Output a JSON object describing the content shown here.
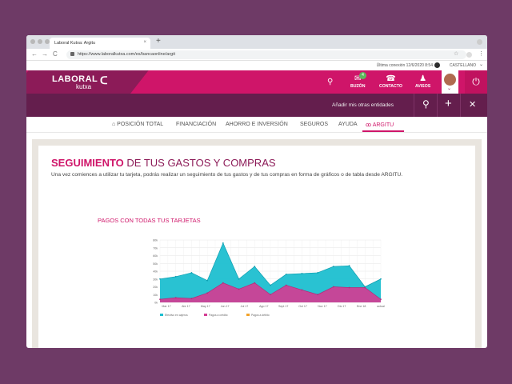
{
  "browser": {
    "tab_title": "Laboral Kutxa: Argitu",
    "tab_close": "×",
    "new_tab": "+",
    "url": "https://www.laboralkutxa.com/es/bancaonline/argit",
    "back": "←",
    "forward": "→",
    "reload": "C",
    "star": "☆",
    "more": "⋮"
  },
  "infobar": {
    "last_connection": "Última conexión 12/6/2020 8:54",
    "language": "CASTELLANO"
  },
  "header": {
    "logo_text": "LABORAL",
    "logo_sub": "kutxa",
    "logo_mark": "ᑕ",
    "icons": [
      {
        "name": "search",
        "glyph": "⚲",
        "label": ""
      },
      {
        "name": "buzon",
        "glyph": "✉",
        "label": "BUZÓN",
        "badge": "4"
      },
      {
        "name": "contacto",
        "glyph": "☎",
        "label": "CONTACTO"
      },
      {
        "name": "avisos",
        "glyph": "♟",
        "label": "AVISOS"
      }
    ],
    "power_glyph": "⏻"
  },
  "subheader": {
    "add_entities": "Añadir mis otras entidades",
    "pin_glyph": "⚲",
    "plus_glyph": "+",
    "close_glyph": "✕"
  },
  "menu": [
    {
      "label": "⌂ POSICIÓN TOTAL",
      "active": false
    },
    {
      "label": "FINANCIACIÓN",
      "active": false
    },
    {
      "label": "AHORRO E INVERSIÓN",
      "active": false
    },
    {
      "label": "SEGUROS",
      "active": false
    },
    {
      "label": "AYUDA",
      "active": false
    },
    {
      "label": "ARGITU",
      "active": true
    }
  ],
  "page": {
    "title_bold": "SEGUIMIENTO",
    "title_rest": " DE TUS GASTOS Y COMPRAS",
    "description": "Una vez comiences a utilizar tu tarjeta, podrás realizar un seguimiento de tus gastos y de tus compras en forma de gráficos o de tabla desde ARGITU.",
    "chart_title": "PAGOS CON TODAS TUS TARJETAS"
  },
  "chart_data": {
    "type": "area",
    "categories": [
      "Mar 17",
      "Abr 17",
      "May 17",
      "Jun 17",
      "Jul 17",
      "Ago 17",
      "Sept 17",
      "Oct 17",
      "Nov 17",
      "Dic 17",
      "Ene 18",
      "actual"
    ],
    "y_ticks": [
      "80k",
      "70k",
      "60k",
      "50k",
      "40k",
      "30k",
      "20k",
      "10k",
      "0k"
    ],
    "ylim": [
      0,
      80000
    ],
    "grid": true,
    "legend_position": "bottom-left",
    "series": [
      {
        "name": "Efectivo en cajeros",
        "color": "#1dbfd0",
        "values": [
          30000,
          33000,
          38000,
          28000,
          76000,
          30000,
          46000,
          22000,
          36000,
          37000,
          38000,
          46000,
          47000,
          20000,
          30000
        ]
      },
      {
        "name": "Pagos a crédito",
        "color": "#d33d93",
        "values": [
          4000,
          6000,
          5000,
          12000,
          25000,
          17000,
          25000,
          10000,
          22000,
          16000,
          10000,
          20000,
          19000,
          19000,
          4000
        ]
      },
      {
        "name": "Pagos a débito",
        "color": "#f3a22a",
        "values": []
      }
    ]
  }
}
